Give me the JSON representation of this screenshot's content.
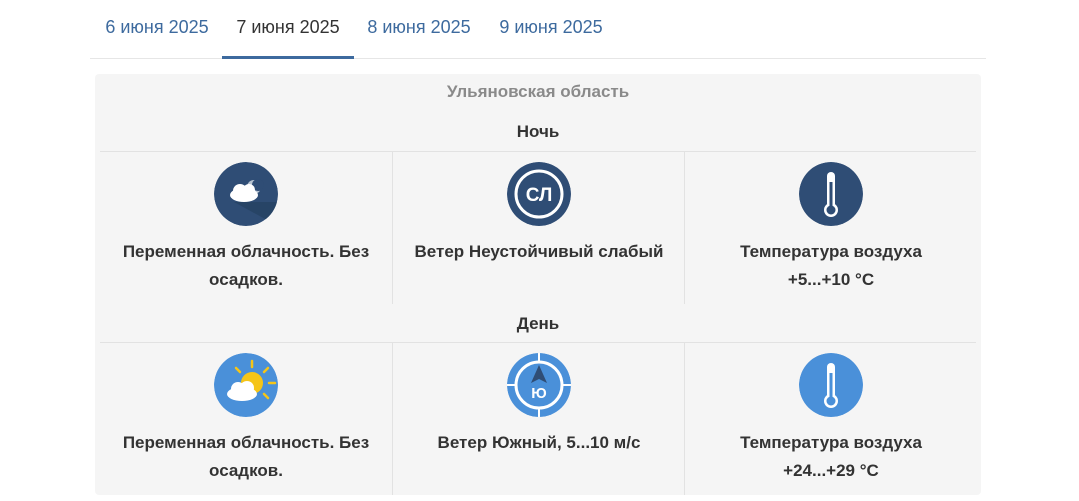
{
  "tabs": [
    {
      "label": "6 июня 2025"
    },
    {
      "label": "7 июня 2025"
    },
    {
      "label": "8 июня 2025"
    },
    {
      "label": "9 июня 2025"
    }
  ],
  "active_tab": "7 июня 2025",
  "region": "Ульяновская область",
  "night": {
    "title": "Ночь",
    "cloud": {
      "line1": "Переменная облачность. Без",
      "line2": "осадков."
    },
    "wind": {
      "line1": "Ветер Неустойчивый слабый",
      "badge": "СЛ"
    },
    "temp": {
      "line1": "Температура воздуха",
      "line2": "+5...+10 °С"
    }
  },
  "day": {
    "title": "День",
    "cloud": {
      "line1": "Переменная облачность. Без",
      "line2": "осадков."
    },
    "wind": {
      "line1": "Ветер Южный, 5...10 м/с",
      "badge": "Ю"
    },
    "temp": {
      "line1": "Температура воздуха",
      "line2": "+24...+29 °С"
    }
  },
  "colors": {
    "accent": "#3d6a9e",
    "night_icon_bg": "#2f4d75",
    "day_icon_bg": "#4a90d9",
    "card_bg": "#f5f5f5"
  },
  "icons": {
    "night": [
      "cloud-moon-icon",
      "wind-calm-icon",
      "thermometer-icon"
    ],
    "day": [
      "sun-cloud-icon",
      "wind-south-icon",
      "thermometer-icon"
    ]
  }
}
